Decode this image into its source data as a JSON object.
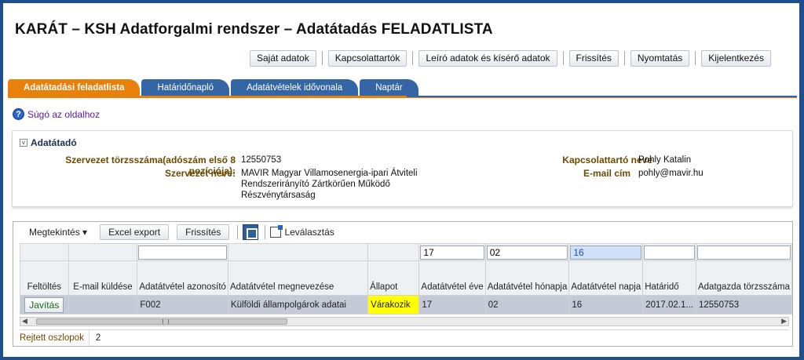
{
  "app": {
    "title": "KARÁT – KSH Adatforgalmi rendszer – Adatátadás FELADATLISTA"
  },
  "topbar": [
    {
      "label": "Saját adatok"
    },
    {
      "label": "Kapcsolattartók"
    },
    {
      "label": "Leíró adatok és kísérő adatok"
    },
    {
      "label": "Frissítés"
    },
    {
      "label": "Nyomtatás"
    },
    {
      "label": "Kijelentkezés"
    }
  ],
  "tabs": [
    {
      "label": "Adatátadási feladatlista",
      "active": true
    },
    {
      "label": "Határidőnapló",
      "active": false
    },
    {
      "label": "Adatátvételek idővonala",
      "active": false
    },
    {
      "label": "Naptár",
      "active": false
    }
  ],
  "help": {
    "label": "Súgó az oldalhoz"
  },
  "adatatado": {
    "title": "Adatátadó",
    "torzsszam_label": "Szervezet törzsszáma(adószám első 8 pozíciója):",
    "torzsszam_value": "12550753",
    "nev_label": "Szervezet neve:",
    "nev_line1": "MAVIR Magyar Villamosenergia-ipari Átviteli",
    "nev_line2": "Rendszerirányító Zártkörűen Működő",
    "nev_line3": "Részvénytársaság",
    "kapcs_label": "Kapcsolattartó neve",
    "kapcs_value": "Pohly Katalin",
    "email_label": "E-mail cím",
    "email_value": "pohly@mavir.hu"
  },
  "grid": {
    "toolbar": {
      "view_menu": "Megtekintés ▾",
      "excel": "Excel export",
      "refresh": "Frissítés",
      "detach": "Leválasztás"
    },
    "filters": {
      "ev": "17",
      "honap": "02",
      "nap": "16"
    },
    "headers": {
      "feltoltes": "Feltöltés",
      "email": "E-mail küldése",
      "azonosito": "Adatátvétel azonosító",
      "megnevezes": "Adatátvétel megnevezése",
      "allapot": "Állapot",
      "ev": "Adatátvétel éve",
      "honap": "Adatátvétel hónapja",
      "nap": "Adatátvétel napja",
      "hatarido": "Határidő",
      "torzsszam": "Adatgazda törzsszáma"
    },
    "row": {
      "button": "Javítás",
      "email": "",
      "azonosito": "F002",
      "megnevezes": "Külföldi állampolgárok adatai",
      "allapot": "Várakozik",
      "ev": "17",
      "honap": "02",
      "nap": "16",
      "hatarido": "2017.02.1...",
      "torzsszam": "12550753"
    },
    "footer": {
      "hidden_label": "Rejtett oszlopok",
      "hidden_count": "2"
    }
  },
  "colors": {
    "accent": "#e8800c",
    "tab_blue": "#3465a4",
    "status_waiting": "#ffff00"
  }
}
